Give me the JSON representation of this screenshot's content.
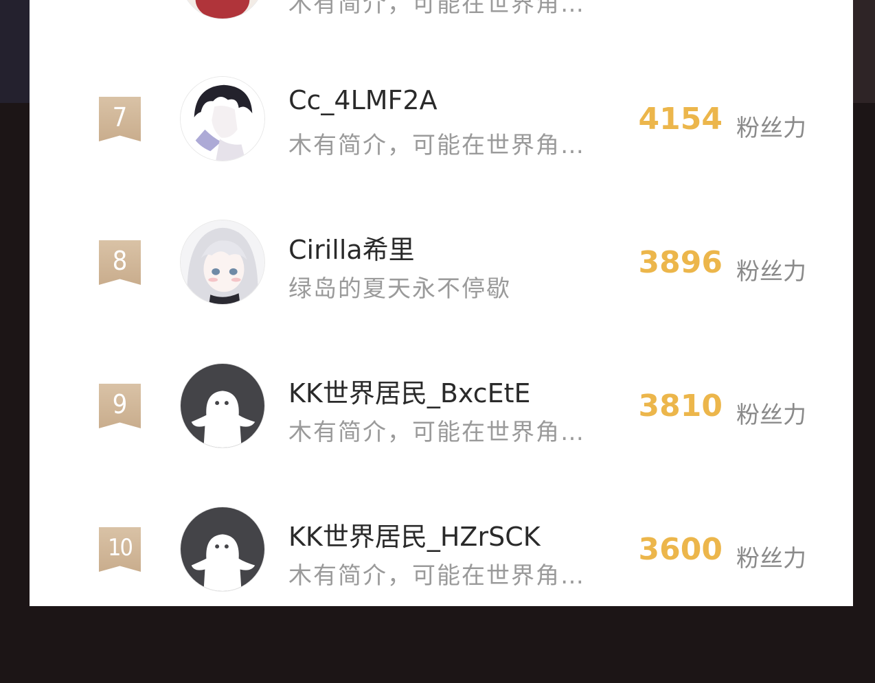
{
  "ranking": {
    "partial_row": {
      "bio": "木有简介，可能在世界角…"
    },
    "rows": [
      {
        "rank": "7",
        "name": "Cc_4LMF2A",
        "bio": "木有简介，可能在世界角…",
        "score": "4154",
        "unit": "粉丝力",
        "avatar": "anime-boy-avatar"
      },
      {
        "rank": "8",
        "name": "Cirilla希里",
        "bio": "绿岛的夏天永不停歇",
        "score": "3896",
        "unit": "粉丝力",
        "avatar": "anime-girl-avatar"
      },
      {
        "rank": "9",
        "name": "KK世界居民_BxcEtE",
        "bio": "木有简介，可能在世界角…",
        "score": "3810",
        "unit": "粉丝力",
        "avatar": "default-ghost-avatar"
      },
      {
        "rank": "10",
        "name": "KK世界居民_HZrSCK",
        "bio": "木有简介，可能在世界角…",
        "score": "3600",
        "unit": "粉丝力",
        "avatar": "default-ghost-avatar"
      }
    ]
  },
  "colors": {
    "score": "#ecb64b",
    "badge": "#d9c2a6",
    "panel": "#ffffff",
    "background": "#1c1516"
  }
}
